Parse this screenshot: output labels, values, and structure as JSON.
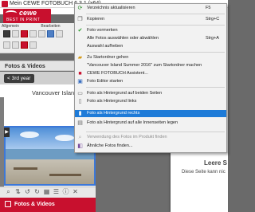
{
  "window": {
    "title": "Mein CEWE FOTOBUCH 6.3.1 (x64)",
    "title_suffix": "CEWE FOTOBUCH 6.3.1"
  },
  "logo": {
    "word": "cewe",
    "tagline": "BEST IN PRINT"
  },
  "toolbar": {
    "group1": "Allgemein",
    "group2": "Bearbeiten"
  },
  "panel": {
    "title": "Fotos & Videos"
  },
  "nav": {
    "back_label": "< 3rd year"
  },
  "album": {
    "title": "Vancouver Island Summer"
  },
  "bottom_panel": {
    "title": "Fotos & Videos"
  },
  "page": {
    "title": "Leere S",
    "subtitle": "Diese Seite kann nic"
  },
  "context_menu": {
    "items": [
      {
        "label": "Verzeichnis aktualisieren",
        "shortcut": "F5",
        "icon": "refresh-icon",
        "state": "normal"
      },
      {
        "label": "Kopieren",
        "shortcut": "Strg+C",
        "icon": "copy-icon",
        "state": "normal"
      },
      {
        "label": "Foto vormerken",
        "shortcut": "",
        "icon": "check-icon",
        "state": "normal"
      },
      {
        "label": "Alle Fotos auswählen oder abwählen",
        "shortcut": "Strg+A",
        "icon": "",
        "state": "normal"
      },
      {
        "label": "Auswahl aufheben",
        "shortcut": "",
        "icon": "",
        "state": "normal"
      },
      {
        "label": "Zu Startordner gehen",
        "shortcut": "",
        "icon": "folder-home-icon",
        "state": "normal"
      },
      {
        "label": "\"Vancouver Island Summer 2016\" zum Startordner machen",
        "shortcut": "",
        "icon": "",
        "state": "normal"
      },
      {
        "label": "CEWE FOTOBUCH Assistent...",
        "shortcut": "",
        "icon": "assistant-icon",
        "state": "normal"
      },
      {
        "label": "Foto Editor starten",
        "shortcut": "",
        "icon": "editor-icon",
        "state": "normal"
      },
      {
        "label": "Foto als Hintergrund auf beiden Seiten",
        "shortcut": "",
        "icon": "bg-both-icon",
        "state": "normal"
      },
      {
        "label": "Foto als Hintergrund links",
        "shortcut": "",
        "icon": "bg-left-icon",
        "state": "normal"
      },
      {
        "label": "Foto als Hintergrund rechts",
        "shortcut": "",
        "icon": "bg-right-icon",
        "state": "highlighted"
      },
      {
        "label": "Foto als Hintergrund auf alle Innenseiten legen",
        "shortcut": "",
        "icon": "bg-all-icon",
        "state": "normal"
      },
      {
        "label": "Verwendung des Fotos im Produkt finden",
        "shortcut": "",
        "icon": "find-usage-icon",
        "state": "disabled"
      },
      {
        "label": "Ähnliche Fotos finden...",
        "shortcut": "",
        "icon": "similar-icon",
        "state": "normal"
      }
    ]
  },
  "colors": {
    "brand_red": "#c8102e",
    "highlight": "#1e7bd8",
    "menu_bg": "#f2f2f2"
  }
}
